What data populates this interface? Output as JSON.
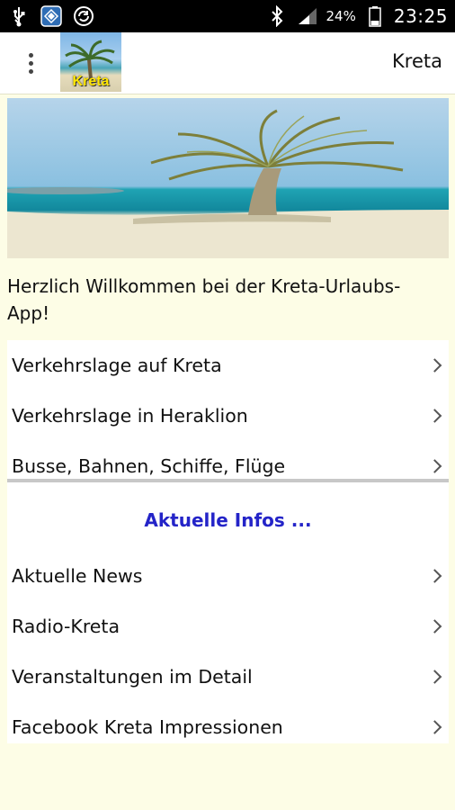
{
  "status_bar": {
    "battery_percent": "24%",
    "time": "23:25",
    "icons": [
      "usb-icon",
      "app-notification-icon",
      "sync-icon",
      "bluetooth-icon",
      "signal-icon",
      "battery-icon"
    ]
  },
  "toolbar": {
    "logo_text": "Kreta",
    "title": "Kreta"
  },
  "welcome_text": "Herzlich Willkommen bei der Kreta-Urlaubs-App!",
  "menu_group_1": [
    {
      "label": "Verkehrslage auf Kreta"
    },
    {
      "label": "Verkehrslage in Heraklion"
    },
    {
      "label": "Busse, Bahnen, Schiffe, Flüge"
    }
  ],
  "section_title": "Aktuelle Infos ...",
  "menu_group_2": [
    {
      "label": "Aktuelle News"
    },
    {
      "label": "Radio-Kreta"
    },
    {
      "label": "Veranstaltungen im Detail"
    },
    {
      "label": "Facebook Kreta Impressionen"
    }
  ],
  "colors": {
    "background": "#fdfde6",
    "section_title": "#2424c8",
    "status_bar": "#000000"
  }
}
